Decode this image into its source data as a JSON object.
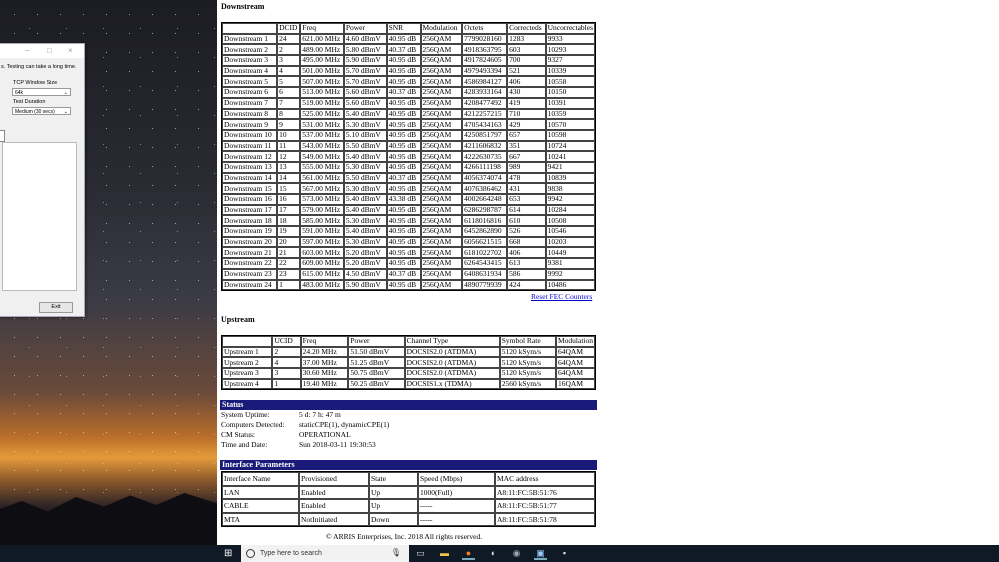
{
  "dialog": {
    "note": "s. Testing can take a long time.",
    "window_label": "TCP Window Size",
    "window_value": "64k",
    "duration_label": "Test Duration",
    "duration_value": "Medium (30 secs)",
    "left_label": "p",
    "exit_label": "Exit"
  },
  "downstream": {
    "title": "Downstream",
    "headers": [
      "",
      "DCID",
      "Freq",
      "Power",
      "SNR",
      "Modulation",
      "Octets",
      "Correcteds",
      "Uncorrectables"
    ],
    "rows": [
      [
        "Downstream 1",
        "24",
        "621.00 MHz",
        "4.60 dBmV",
        "40.95 dB",
        "256QAM",
        "7799028160",
        "1283",
        "9933"
      ],
      [
        "Downstream 2",
        "2",
        "489.00 MHz",
        "5.80 dBmV",
        "40.37 dB",
        "256QAM",
        "4918363795",
        "603",
        "10293"
      ],
      [
        "Downstream 3",
        "3",
        "495.00 MHz",
        "5.90 dBmV",
        "40.95 dB",
        "256QAM",
        "4917824605",
        "700",
        "9327"
      ],
      [
        "Downstream 4",
        "4",
        "501.00 MHz",
        "5.70 dBmV",
        "40.95 dB",
        "256QAM",
        "4979493394",
        "521",
        "10339"
      ],
      [
        "Downstream 5",
        "5",
        "507.00 MHz",
        "5.70 dBmV",
        "40.95 dB",
        "256QAM",
        "4586984127",
        "406",
        "10558"
      ],
      [
        "Downstream 6",
        "6",
        "513.00 MHz",
        "5.60 dBmV",
        "40.37 dB",
        "256QAM",
        "4283933164",
        "430",
        "10150"
      ],
      [
        "Downstream 7",
        "7",
        "519.00 MHz",
        "5.60 dBmV",
        "40.95 dB",
        "256QAM",
        "4208477492",
        "419",
        "10391"
      ],
      [
        "Downstream 8",
        "8",
        "525.00 MHz",
        "5.40 dBmV",
        "40.95 dB",
        "256QAM",
        "4212257215",
        "710",
        "10359"
      ],
      [
        "Downstream 9",
        "9",
        "531.00 MHz",
        "5.30 dBmV",
        "40.95 dB",
        "256QAM",
        "4705434163",
        "429",
        "10570"
      ],
      [
        "Downstream 10",
        "10",
        "537.00 MHz",
        "5.10 dBmV",
        "40.95 dB",
        "256QAM",
        "4250851797",
        "657",
        "10598"
      ],
      [
        "Downstream 11",
        "11",
        "543.00 MHz",
        "5.50 dBmV",
        "40.95 dB",
        "256QAM",
        "4211606832",
        "351",
        "10724"
      ],
      [
        "Downstream 12",
        "12",
        "549.00 MHz",
        "5.40 dBmV",
        "40.95 dB",
        "256QAM",
        "4222630735",
        "667",
        "10241"
      ],
      [
        "Downstream 13",
        "13",
        "555.00 MHz",
        "5.30 dBmV",
        "40.95 dB",
        "256QAM",
        "4266111198",
        "989",
        "9421"
      ],
      [
        "Downstream 14",
        "14",
        "561.00 MHz",
        "5.50 dBmV",
        "40.37 dB",
        "256QAM",
        "4056374074",
        "478",
        "10839"
      ],
      [
        "Downstream 15",
        "15",
        "567.00 MHz",
        "5.30 dBmV",
        "40.95 dB",
        "256QAM",
        "4076386462",
        "431",
        "9838"
      ],
      [
        "Downstream 16",
        "16",
        "573.00 MHz",
        "5.40 dBmV",
        "43.38 dB",
        "256QAM",
        "4002664248",
        "653",
        "9942"
      ],
      [
        "Downstream 17",
        "17",
        "579.00 MHz",
        "5.40 dBmV",
        "40.95 dB",
        "256QAM",
        "6286298787",
        "614",
        "10284"
      ],
      [
        "Downstream 18",
        "18",
        "585.00 MHz",
        "5.30 dBmV",
        "40.95 dB",
        "256QAM",
        "6118016816",
        "610",
        "10508"
      ],
      [
        "Downstream 19",
        "19",
        "591.00 MHz",
        "5.40 dBmV",
        "40.95 dB",
        "256QAM",
        "6452862890",
        "526",
        "10546"
      ],
      [
        "Downstream 20",
        "20",
        "597.00 MHz",
        "5.30 dBmV",
        "40.95 dB",
        "256QAM",
        "6056621515",
        "668",
        "10203"
      ],
      [
        "Downstream 21",
        "21",
        "603.00 MHz",
        "5.20 dBmV",
        "40.95 dB",
        "256QAM",
        "6181022702",
        "406",
        "10449"
      ],
      [
        "Downstream 22",
        "22",
        "609.00 MHz",
        "5.20 dBmV",
        "40.95 dB",
        "256QAM",
        "6264543415",
        "613",
        "9381"
      ],
      [
        "Downstream 23",
        "23",
        "615.00 MHz",
        "4.50 dBmV",
        "40.37 dB",
        "256QAM",
        "6408631934",
        "586",
        "9992"
      ],
      [
        "Downstream 24",
        "1",
        "483.00 MHz",
        "5.90 dBmV",
        "40.95 dB",
        "256QAM",
        "4890779939",
        "424",
        "10486"
      ]
    ],
    "reset_link": "Reset FEC Counters"
  },
  "upstream": {
    "title": "Upstream",
    "headers": [
      "",
      "UCID",
      "Freq",
      "Power",
      "Channel Type",
      "Symbol Rate",
      "Modulation"
    ],
    "rows": [
      [
        "Upstream 1",
        "2",
        "24.20 MHz",
        "51.50 dBmV",
        "DOCSIS2.0 (ATDMA)",
        "5120 kSym/s",
        "64QAM"
      ],
      [
        "Upstream 2",
        "4",
        "37.00 MHz",
        "51.25 dBmV",
        "DOCSIS2.0 (ATDMA)",
        "5120 kSym/s",
        "64QAM"
      ],
      [
        "Upstream 3",
        "3",
        "30.60 MHz",
        "50.75 dBmV",
        "DOCSIS2.0 (ATDMA)",
        "5120 kSym/s",
        "64QAM"
      ],
      [
        "Upstream 4",
        "1",
        "19.40 MHz",
        "50.25 dBmV",
        "DOCSIS1.x (TDMA)",
        "2560 kSym/s",
        "16QAM"
      ]
    ]
  },
  "status": {
    "title": "Status",
    "items": [
      {
        "label": "System Uptime:",
        "value": "5 d: 7 h: 47 m"
      },
      {
        "label": "Computers Detected:",
        "value": "staticCPE(1), dynamicCPE(1)"
      },
      {
        "label": "CM Status:",
        "value": "OPERATIONAL"
      },
      {
        "label": "Time and Date:",
        "value": "Sun 2018-03-11 19:30:53"
      }
    ]
  },
  "interface": {
    "title": "Interface Parameters",
    "headers": [
      "Interface Name",
      "Provisioned",
      "State",
      "Speed (Mbps)",
      "MAC address"
    ],
    "rows": [
      [
        "LAN",
        "Enabled",
        "Up",
        "1000(Full)",
        "A8:11:FC:5B:51:76"
      ],
      [
        "CABLE",
        "Enabled",
        "Up",
        "-----",
        "A8:11:FC:5B:51:77"
      ],
      [
        "MTA",
        "NotInitiated",
        "Down",
        "-----",
        "A8:11:FC:5B:51:78"
      ]
    ]
  },
  "footer": "© ARRIS Enterprises, Inc. 2018 All rights reserved.",
  "taskbar": {
    "search_placeholder": "Type here to search",
    "icons": [
      "windows-start-icon",
      "task-view-icon",
      "file-explorer-icon",
      "firefox-icon",
      "shield-app-icon",
      "steam-icon",
      "network-app-icon",
      "terminal-icon"
    ]
  },
  "colors": {
    "section_bar": "#1a1a7a",
    "link": "#0000cc",
    "taskbar": "#101a27"
  }
}
